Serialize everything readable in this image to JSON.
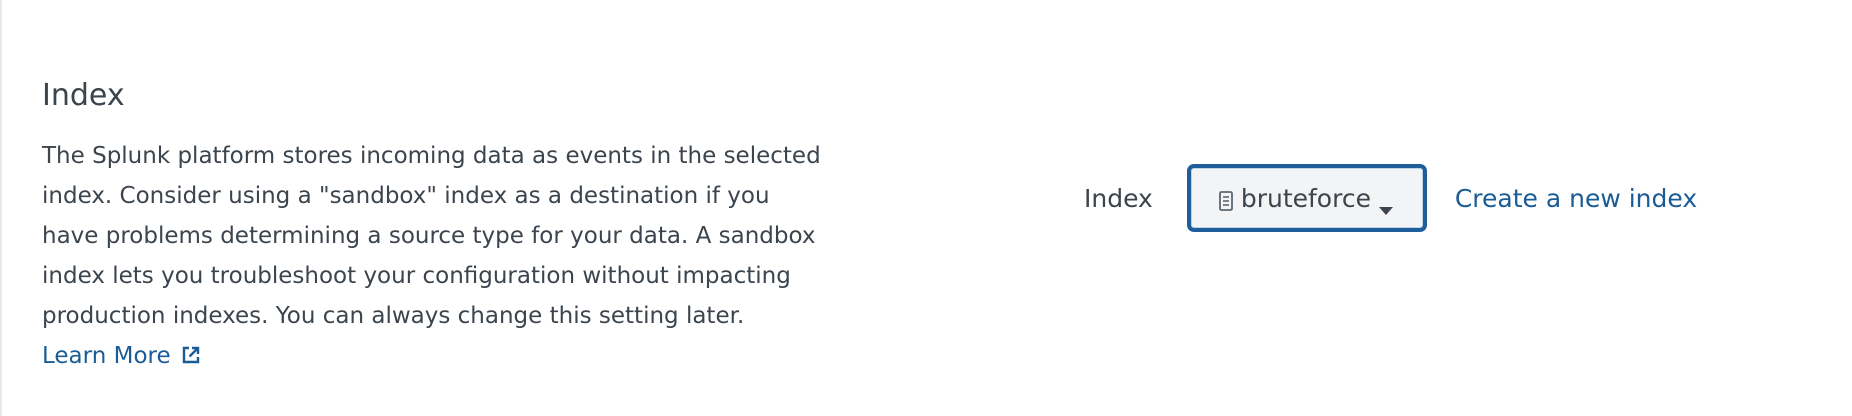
{
  "section": {
    "title": "Index",
    "description": "The Splunk platform stores incoming data as events in the selected index. Consider using a \"sandbox\" index as a destination if you have problems determining a source type for your data. A sandbox index lets you troubleshoot your configuration without impacting production indexes. You can always change this setting later.",
    "learn_more_label": "Learn More",
    "learn_more_icon": "external-link-icon"
  },
  "index_field": {
    "label": "Index",
    "selected_value": "bruteforce",
    "value_icon": "database-icon",
    "dropdown_icon": "caret-down-icon",
    "create_link_label": "Create a new index"
  },
  "colors": {
    "text": "#3c444d",
    "link": "#1a5c96",
    "select_border": "#1f5d9b",
    "select_background": "#f2f4f5"
  }
}
